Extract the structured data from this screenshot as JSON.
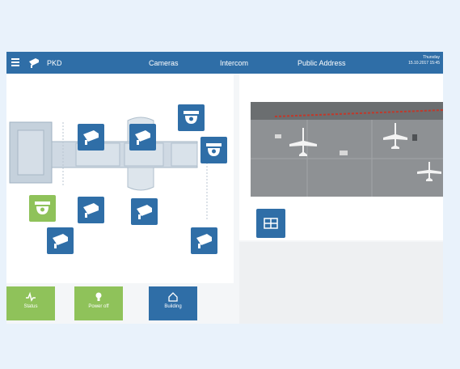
{
  "topbar": {
    "app_name": "PKD",
    "nav": [
      "Cameras",
      "Intercom",
      "Public Address"
    ],
    "datetime_line1": "Thursday",
    "datetime_line2": "15.10.2017 15:45"
  },
  "bottom_buttons": [
    {
      "label": "Status",
      "icon": "pulse-icon",
      "color": "#8fc25a"
    },
    {
      "label": "Power off",
      "icon": "bulb-icon",
      "color": "#8fc25a"
    },
    {
      "label": "Building",
      "icon": "home-icon",
      "color": "#2f6ea7"
    }
  ],
  "colors": {
    "primary": "#2f6ea7",
    "green": "#8fc25a",
    "background": "#e9f2fb"
  },
  "cameras": [
    {
      "type": "bullet",
      "status": "blue"
    },
    {
      "type": "bullet",
      "status": "blue"
    },
    {
      "type": "dome",
      "status": "blue"
    },
    {
      "type": "dome",
      "status": "blue"
    },
    {
      "type": "dome",
      "status": "green"
    },
    {
      "type": "bullet",
      "status": "blue"
    },
    {
      "type": "bullet",
      "status": "blue"
    },
    {
      "type": "bullet",
      "status": "blue"
    },
    {
      "type": "bullet",
      "status": "blue"
    }
  ]
}
